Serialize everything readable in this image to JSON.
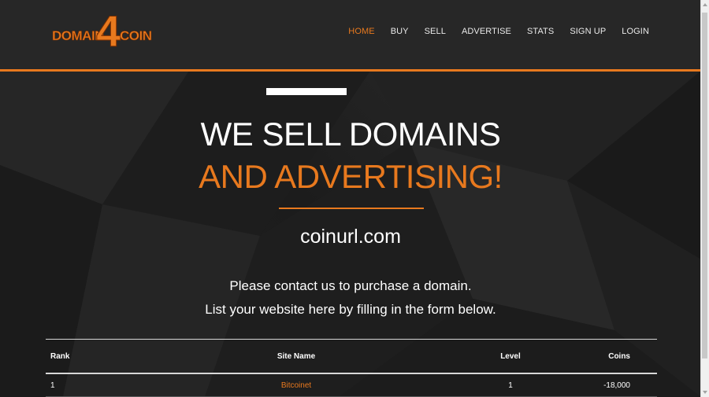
{
  "logo": {
    "left_word": "DOMAIN",
    "number": "4",
    "right_word": "COIN"
  },
  "nav": {
    "items": [
      {
        "label": "HOME",
        "active": true
      },
      {
        "label": "BUY"
      },
      {
        "label": "SELL"
      },
      {
        "label": "ADVERTISE"
      },
      {
        "label": "STATS"
      },
      {
        "label": "SIGN UP"
      },
      {
        "label": "LOGIN"
      }
    ]
  },
  "hero": {
    "line1": "WE SELL DOMAINS",
    "line2": "AND ADVERTISING!",
    "domain": "coinurl.com",
    "message1": "Please contact us to purchase a domain.",
    "message2": "List your website here by filling in the form below."
  },
  "table": {
    "headers": {
      "rank": "Rank",
      "site_name": "Site Name",
      "level": "Level",
      "coins": "Coins"
    },
    "rows": [
      {
        "rank": "1",
        "site_name": "Bitcoinet",
        "level": "1",
        "coins": "-18,000"
      }
    ]
  },
  "colors": {
    "accent": "#e8791e",
    "background": "#1f1f1f",
    "header_bg": "#272727",
    "text": "#ffffff"
  }
}
